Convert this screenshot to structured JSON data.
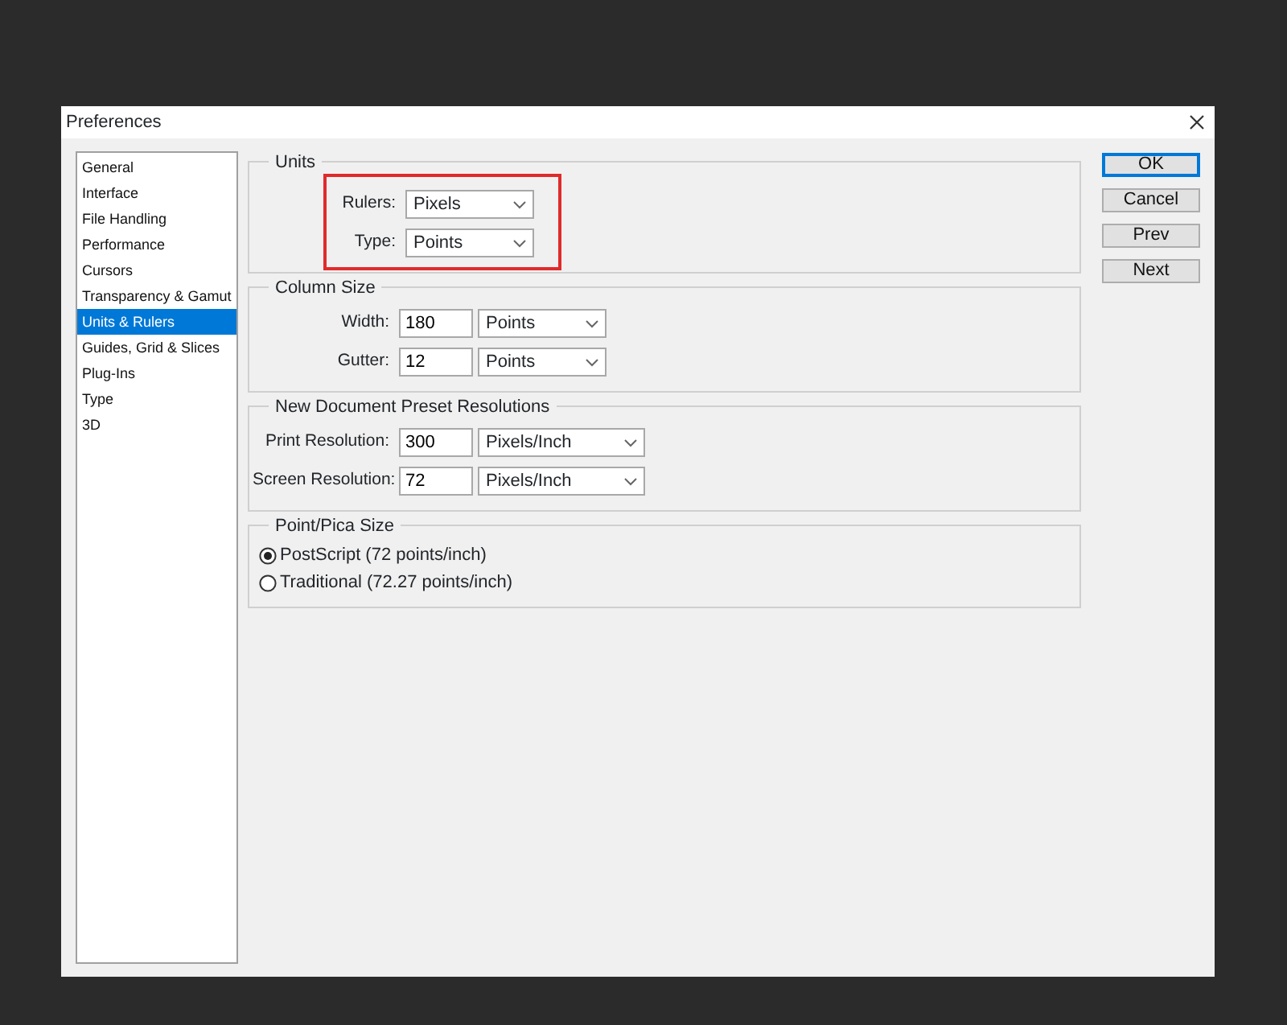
{
  "window": {
    "title": "Preferences"
  },
  "sidebar": {
    "items": [
      {
        "label": "General",
        "selected": false
      },
      {
        "label": "Interface",
        "selected": false
      },
      {
        "label": "File Handling",
        "selected": false
      },
      {
        "label": "Performance",
        "selected": false
      },
      {
        "label": "Cursors",
        "selected": false
      },
      {
        "label": "Transparency & Gamut",
        "selected": false
      },
      {
        "label": "Units & Rulers",
        "selected": true
      },
      {
        "label": "Guides, Grid & Slices",
        "selected": false
      },
      {
        "label": "Plug-Ins",
        "selected": false
      },
      {
        "label": "Type",
        "selected": false
      },
      {
        "label": "3D",
        "selected": false
      }
    ]
  },
  "groups": [
    {
      "title": "Units",
      "highlighted": true,
      "rows": [
        {
          "kind": "select",
          "label": "Rulers:",
          "unit": "Pixels"
        },
        {
          "kind": "select",
          "label": "Type:",
          "unit": "Points"
        }
      ]
    },
    {
      "title": "Column Size",
      "highlighted": false,
      "rows": [
        {
          "kind": "input_select",
          "label": "Width:",
          "value": "180",
          "unit": "Points"
        },
        {
          "kind": "input_select",
          "label": "Gutter:",
          "value": "12",
          "unit": "Points"
        }
      ]
    },
    {
      "title": "New Document Preset Resolutions",
      "highlighted": false,
      "rows": [
        {
          "kind": "input_wide_select",
          "label": "Print Resolution:",
          "value": "300",
          "unit": "Pixels/Inch"
        },
        {
          "kind": "input_wide_select",
          "label": "Screen Resolution:",
          "value": "72",
          "unit": "Pixels/Inch"
        }
      ]
    },
    {
      "title": "Point/Pica Size",
      "highlighted": false,
      "rows": [
        {
          "kind": "radio",
          "label": "PostScript (72 points/inch)",
          "selected": true
        },
        {
          "kind": "radio",
          "label": "Traditional (72.27 points/inch)",
          "selected": false
        }
      ]
    }
  ],
  "buttons": [
    {
      "label": "OK",
      "default": true
    },
    {
      "label": "Cancel",
      "default": false
    },
    {
      "label": "Prev",
      "default": false
    },
    {
      "label": "Next",
      "default": false
    }
  ]
}
